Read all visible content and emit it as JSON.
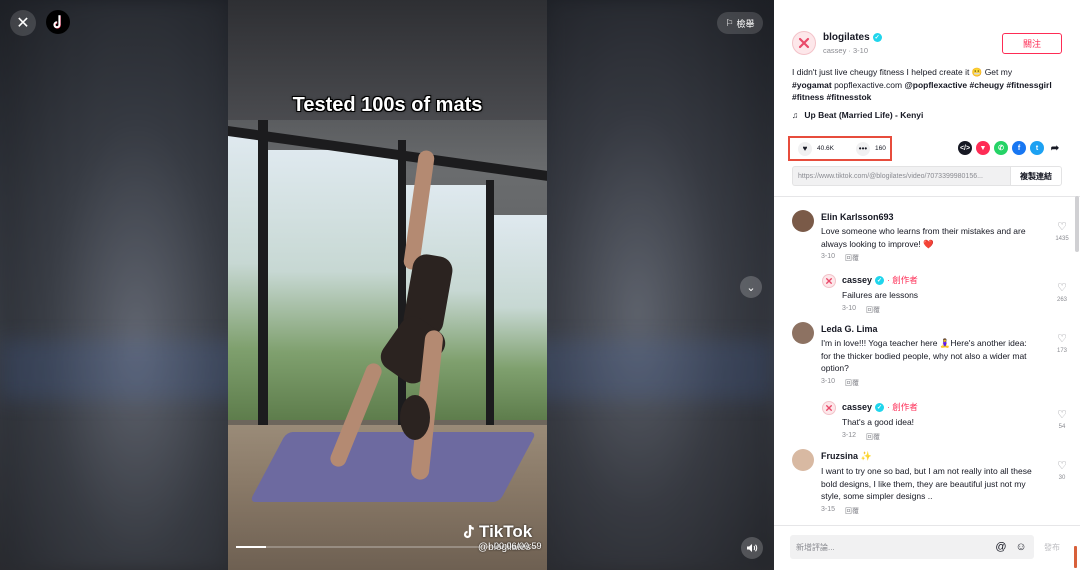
{
  "header": {
    "report_label": "檢舉"
  },
  "video": {
    "caption": "Tested 100s of mats",
    "watermark_brand": "TikTok",
    "watermark_user": "@blogilates",
    "time": "00:06/00:59",
    "progress": 0.1
  },
  "author": {
    "name": "blogilates",
    "meta": "cassey · 3-10",
    "follow_label": "關注"
  },
  "description": {
    "text": "I didn't just live cheugy fitness I helped create it 😬 Get my",
    "tag_yogamat": "#yogamat",
    "url_text": "popflexactive.com",
    "mention": "@popflexactive",
    "tag_cheugy": "#cheugy",
    "tag_fitnessgirl": "#fitnessgirl",
    "tag_fitness": "#fitness",
    "tag_fitnesstok": "#fitnesstok"
  },
  "music": {
    "title": "Up Beat (Married Life) - Kenyi"
  },
  "stats": {
    "likes": "40.6K",
    "comments": "160"
  },
  "share": {
    "icons": [
      "embed-icon",
      "friends-icon",
      "whatsapp-icon",
      "facebook-icon",
      "twitter-icon",
      "share-arrow-icon"
    ],
    "colors": {
      "embed": "#161823",
      "friends": "#fe2c55",
      "whatsapp": "#25d366",
      "facebook": "#1877f2",
      "twitter": "#1da1f2"
    }
  },
  "link": {
    "url": "https://www.tiktok.com/@blogilates/video/7073399980156...",
    "copy_label": "複製連結"
  },
  "comments": [
    {
      "name": "Elin Karlsson693",
      "text": "Love someone who learns from their mistakes and are always looking to improve! ❤️",
      "date": "3-10",
      "reply": "回覆",
      "likes": "1435"
    },
    {
      "name": "cassey",
      "creator": "· 創作者",
      "text": "Failures are lessons",
      "date": "3-10",
      "reply": "回覆",
      "likes": "263"
    },
    {
      "name": "Leda G. Lima",
      "text": "I'm in love!!! Yoga teacher here 🧘‍♀️Here's another idea: for the thicker bodied people, why not also a wider mat option?",
      "date": "3-10",
      "reply": "回覆",
      "likes": "173"
    },
    {
      "name": "cassey",
      "creator": "· 創作者",
      "text": "That's a good idea!",
      "date": "3-12",
      "reply": "回覆",
      "likes": "54"
    },
    {
      "name": "Fruzsina ✨",
      "text": "I want to try one so bad, but I am not really into all these bold designs, I like them, they are beautiful just not my style, some simpler designs ..",
      "date": "3-15",
      "reply": "回覆",
      "likes": "30"
    }
  ],
  "comment_box": {
    "placeholder": "新增評論...",
    "post_label": "發布"
  }
}
